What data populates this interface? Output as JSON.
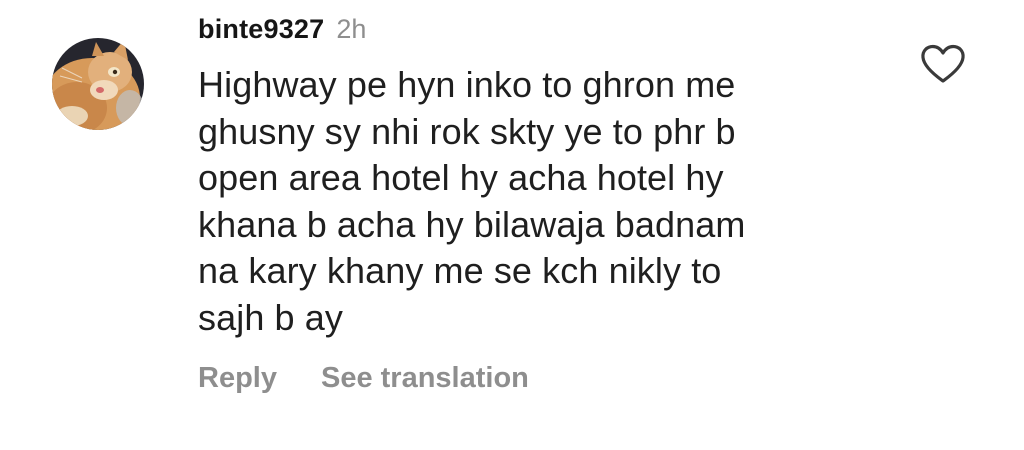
{
  "comment": {
    "username": "binte9327",
    "timestamp": "2h",
    "lines": [
      "Highway pe hyn inko to ghron me",
      "ghusny sy nhi rok skty ye to phr b",
      "open area hotel hy acha hotel hy",
      "khana b acha hy bilawaja badnam",
      "na kary khany me se kch nikly to",
      "sajh b ay"
    ],
    "actions": {
      "reply": "Reply",
      "see_translation": "See translation"
    },
    "avatar": "cat-photo-avatar",
    "like_icon": "heart-outline-icon"
  },
  "colors": {
    "text": "#1f1f1f",
    "muted": "#8e8e8e",
    "background": "#ffffff"
  }
}
